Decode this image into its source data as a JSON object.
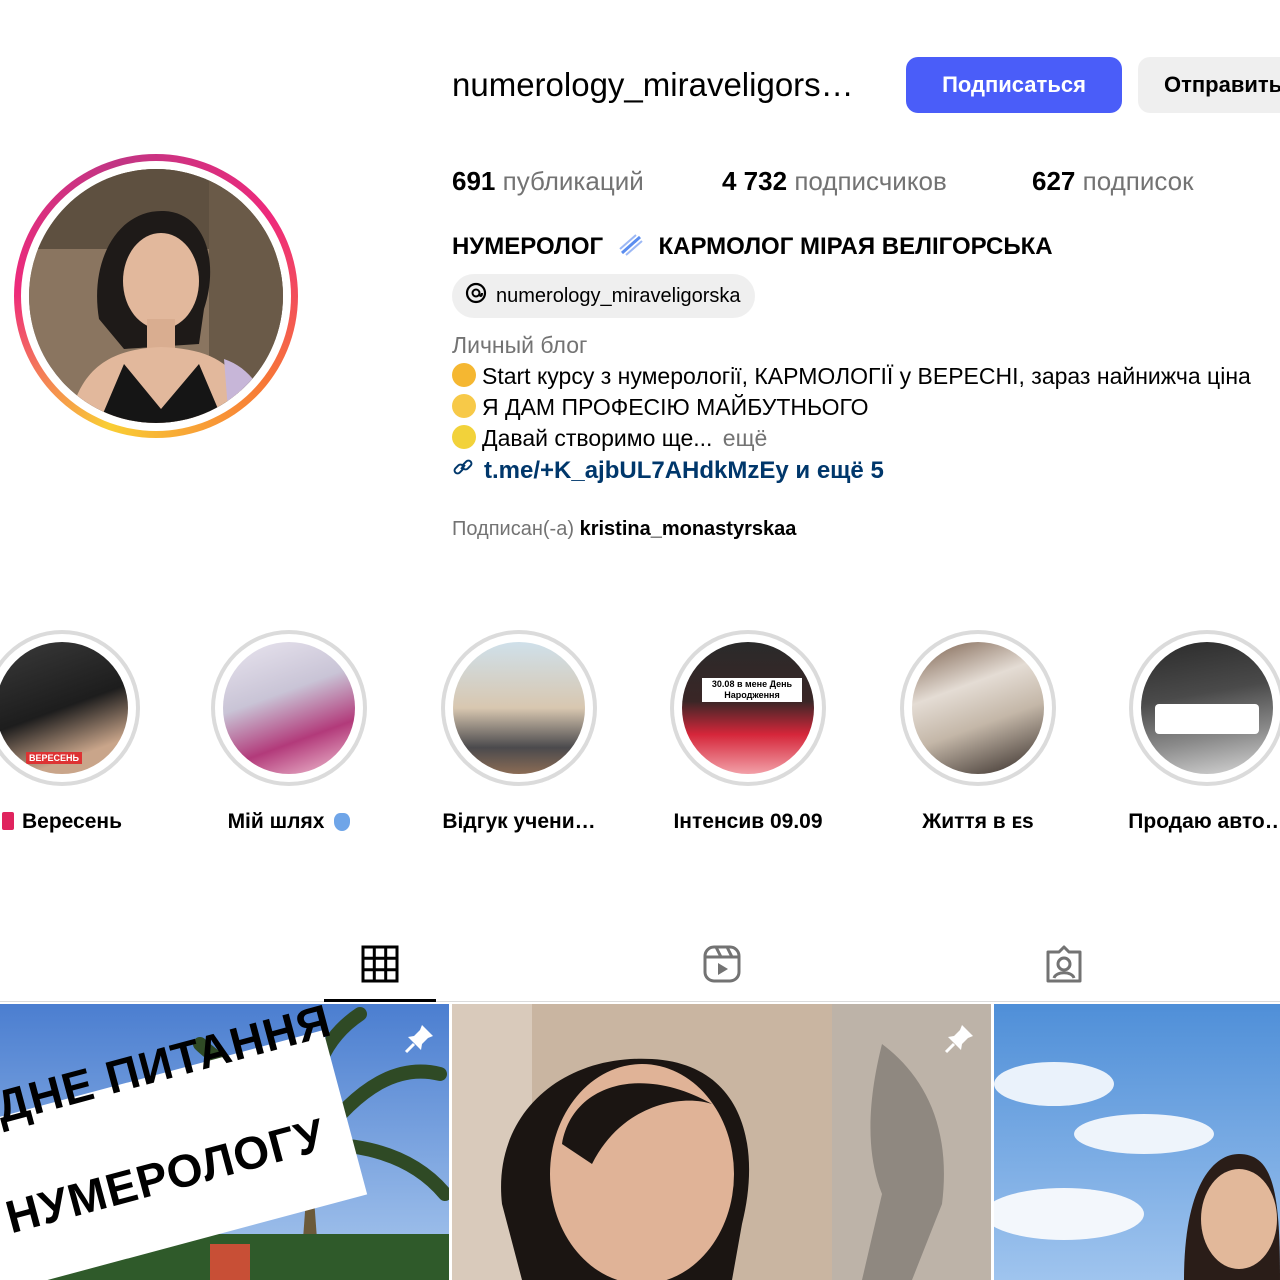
{
  "profile": {
    "username": "numerology_miraveligors…",
    "follow_label": "Подписаться",
    "message_label": "Отправить",
    "stats": [
      {
        "value": "691",
        "label": "публикаций"
      },
      {
        "value": "4 732",
        "label": "подписчиков"
      },
      {
        "value": "627",
        "label": "подписок"
      }
    ],
    "fullname_left": "НУМЕРОЛОГ",
    "fullname_right": "КАРМОЛОГ МІРАЯ ВЕЛІГОРСЬКА",
    "threads_handle": "numerology_miraveligorska",
    "category": "Личный блог",
    "bio": [
      "Start курсу з нумерології, КАРМОЛОГІЇ у ВЕРЕСНІ, зараз найнижча ціна",
      "Я ДАМ ПРОФЕСІЮ МАЙБУТНЬОГО",
      "Давай створимо ще..."
    ],
    "more_label": "ещё",
    "link_text": "t.me/+K_ajbUL7AHdkMzEy и ещё 5",
    "followed_by_label": "Подписан(-а)",
    "followed_by_user": "kristina_monastyrskaa"
  },
  "highlights": [
    {
      "label": "Вересень",
      "thumb": "ВЕРЕСЕНЬ"
    },
    {
      "label": "Мій шлях",
      "thumb": ""
    },
    {
      "label": "Відгук учени…",
      "thumb": ""
    },
    {
      "label": "Інтенсив 09.09",
      "thumb": "30.08 в мене День Народження"
    },
    {
      "label": "Життя в ᴇs",
      "thumb": ""
    },
    {
      "label": "Продаю авто…",
      "thumb": ""
    }
  ],
  "posts": [
    {
      "caption_line1": "ДНЕ ПИТАННЯ",
      "caption_line2": "НУМЕРОЛОГУ",
      "pinned": true
    },
    {
      "caption_line1": "",
      "caption_line2": "",
      "pinned": true
    },
    {
      "caption_line1": "",
      "caption_line2": "",
      "pinned": false
    }
  ],
  "colors": {
    "accent": "#4a5df9",
    "link": "#00376b",
    "muted": "#737373"
  },
  "icons": {
    "threads": "threads-icon",
    "link": "link-icon",
    "grid_tab": "grid-icon",
    "reels_tab": "reels-icon",
    "tagged_tab": "tagged-icon",
    "pin": "pin-icon"
  }
}
